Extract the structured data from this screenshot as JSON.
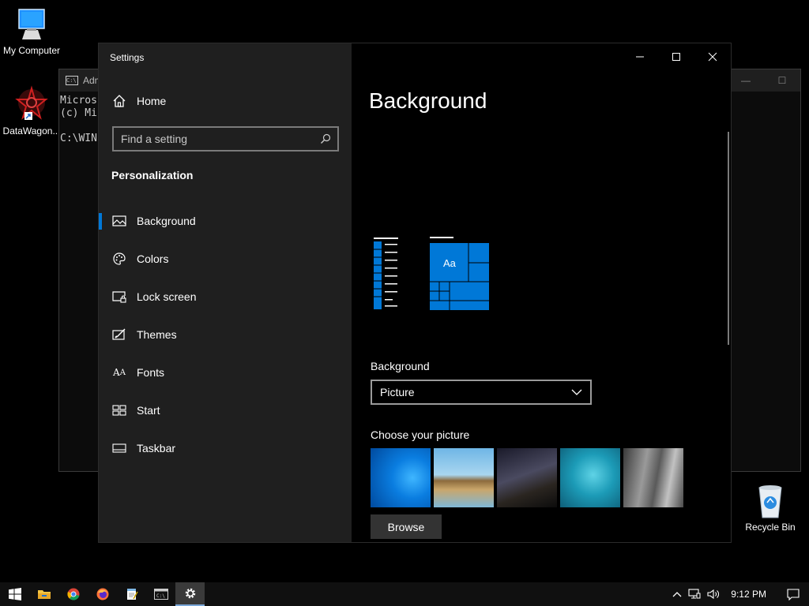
{
  "desktop": {
    "icons": [
      {
        "label": "My Computer"
      },
      {
        "label": "DataWagon..."
      },
      {
        "label": "Recycle Bin"
      }
    ]
  },
  "cmd": {
    "title": "Adm",
    "lines": [
      "Micros",
      "(c) Mi",
      "",
      "C:\\WINI"
    ]
  },
  "settings": {
    "app_title": "Settings",
    "home": "Home",
    "search_placeholder": "Find a setting",
    "section": "Personalization",
    "nav": [
      {
        "label": "Background",
        "icon": "picture-icon",
        "active": true
      },
      {
        "label": "Colors",
        "icon": "palette-icon"
      },
      {
        "label": "Lock screen",
        "icon": "lock-screen-icon"
      },
      {
        "label": "Themes",
        "icon": "themes-icon"
      },
      {
        "label": "Fonts",
        "icon": "fonts-icon"
      },
      {
        "label": "Start",
        "icon": "start-tiles-icon"
      },
      {
        "label": "Taskbar",
        "icon": "taskbar-icon"
      }
    ],
    "page_title": "Background",
    "preview_tile_text": "Aa",
    "background_label": "Background",
    "background_value": "Picture",
    "choose_label": "Choose your picture",
    "browse_label": "Browse",
    "accent": "#0078d7"
  },
  "taskbar": {
    "apps": [
      "start-icon",
      "file-explorer-icon",
      "chrome-icon",
      "firefox-icon",
      "notepad-icon",
      "cmd-icon",
      "settings-icon"
    ],
    "time": "9:12 PM"
  }
}
